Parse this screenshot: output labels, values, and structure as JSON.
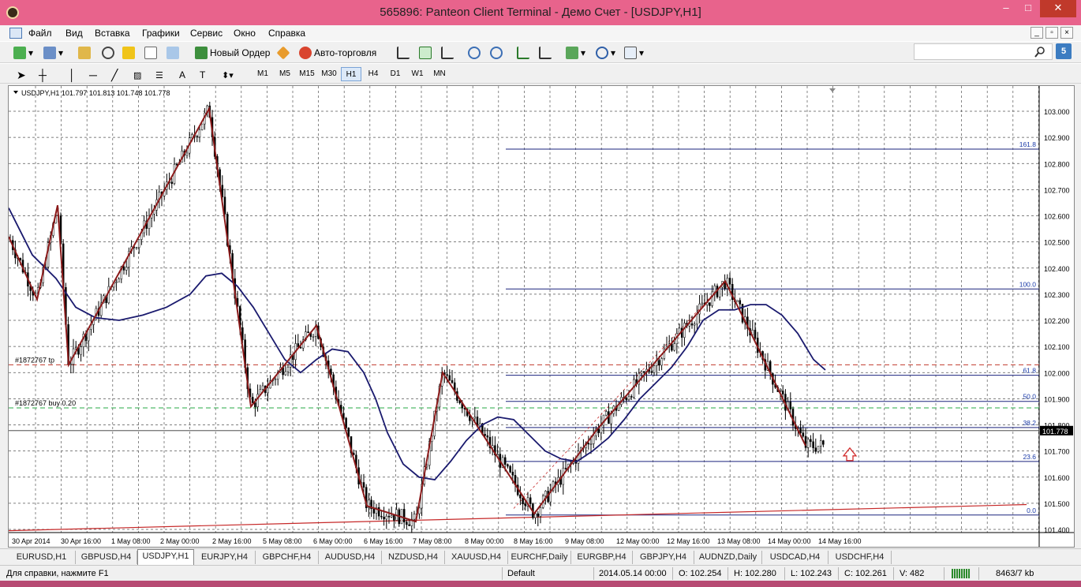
{
  "window": {
    "title": "565896: Panteon Client Terminal - Демо Счет - [USDJPY,H1]",
    "min_glyph": "–",
    "max_glyph": "□",
    "close_glyph": "✕"
  },
  "menu": [
    "Файл",
    "Вид",
    "Вставка",
    "Графики",
    "Сервис",
    "Окно",
    "Справка"
  ],
  "toolbar": {
    "new_order_label": "Новый Ордер",
    "autotrading_label": "Авто-торговля",
    "search_value": "",
    "alert_badge": "5"
  },
  "timeframes": [
    "M1",
    "M5",
    "M15",
    "M30",
    "H1",
    "H4",
    "D1",
    "W1",
    "MN"
  ],
  "active_timeframe": "H1",
  "chart_data": {
    "type": "line",
    "symbol_header": "USDJPY,H1  101.797 101.813 101.748 101.778",
    "y_ticks": [
      "103.000",
      "102.900",
      "102.800",
      "102.700",
      "102.600",
      "102.500",
      "102.400",
      "102.300",
      "102.200",
      "102.100",
      "102.000",
      "101.900",
      "101.800",
      "101.700",
      "101.600",
      "101.500",
      "101.400"
    ],
    "ylim": [
      101.38,
      103.06
    ],
    "x_ticks": [
      "30 Apr 2014",
      "30 Apr 16:00",
      "1 May 08:00",
      "2 May 00:00",
      "2 May 16:00",
      "5 May 08:00",
      "6 May 00:00",
      "6 May 16:00",
      "7 May 08:00",
      "8 May 00:00",
      "8 May 16:00",
      "9 May 08:00",
      "12 May 00:00",
      "12 May 16:00",
      "13 May 08:00",
      "14 May 00:00",
      "14 May 16:00"
    ],
    "current_price_label": "101.778",
    "current_price": 101.778,
    "order_lines": [
      {
        "label": "#1872767 tp",
        "price": 102.03,
        "color": "#c0392b"
      },
      {
        "label": "#1872767 buy 0.20",
        "price": 101.865,
        "color": "#27a844"
      }
    ],
    "fibo_levels": [
      {
        "label": "161.8",
        "price": 102.855
      },
      {
        "label": "100.0",
        "price": 102.32
      },
      {
        "label": "61.8",
        "price": 101.99
      },
      {
        "label": "50.0",
        "price": 101.89
      },
      {
        "label": "38.2",
        "price": 101.79
      },
      {
        "label": "23.6",
        "price": 101.66
      },
      {
        "label": "0.0",
        "price": 101.455
      }
    ],
    "zigzag": [
      [
        0,
        102.52
      ],
      [
        36,
        102.28
      ],
      [
        62,
        102.64
      ],
      [
        76,
        102.03
      ],
      [
        254,
        103.01
      ],
      [
        307,
        101.87
      ],
      [
        390,
        102.18
      ],
      [
        454,
        101.49
      ],
      [
        516,
        101.43
      ],
      [
        550,
        102.0
      ],
      [
        666,
        101.46
      ],
      [
        745,
        101.78
      ],
      [
        908,
        102.35
      ],
      [
        936,
        102.18
      ],
      [
        1010,
        101.72
      ]
    ],
    "moving_average": [
      [
        0,
        102.63
      ],
      [
        30,
        102.45
      ],
      [
        60,
        102.36
      ],
      [
        85,
        102.25
      ],
      [
        110,
        102.21
      ],
      [
        140,
        102.2
      ],
      [
        170,
        102.22
      ],
      [
        200,
        102.25
      ],
      [
        230,
        102.3
      ],
      [
        250,
        102.37
      ],
      [
        270,
        102.38
      ],
      [
        290,
        102.33
      ],
      [
        310,
        102.25
      ],
      [
        330,
        102.15
      ],
      [
        350,
        102.05
      ],
      [
        370,
        102.0
      ],
      [
        390,
        102.05
      ],
      [
        410,
        102.09
      ],
      [
        430,
        102.08
      ],
      [
        450,
        102.0
      ],
      [
        465,
        101.9
      ],
      [
        480,
        101.77
      ],
      [
        500,
        101.65
      ],
      [
        520,
        101.6
      ],
      [
        540,
        101.59
      ],
      [
        560,
        101.66
      ],
      [
        580,
        101.74
      ],
      [
        600,
        101.8
      ],
      [
        620,
        101.83
      ],
      [
        640,
        101.82
      ],
      [
        660,
        101.76
      ],
      [
        680,
        101.7
      ],
      [
        700,
        101.67
      ],
      [
        720,
        101.66
      ],
      [
        740,
        101.7
      ],
      [
        760,
        101.75
      ],
      [
        780,
        101.82
      ],
      [
        800,
        101.9
      ],
      [
        820,
        101.96
      ],
      [
        840,
        102.02
      ],
      [
        860,
        102.1
      ],
      [
        880,
        102.2
      ],
      [
        900,
        102.24
      ],
      [
        920,
        102.24
      ],
      [
        940,
        102.26
      ],
      [
        960,
        102.26
      ],
      [
        980,
        102.22
      ],
      [
        1000,
        102.15
      ],
      [
        1020,
        102.05
      ],
      [
        1035,
        102.01
      ]
    ],
    "trendline": [
      [
        0,
        101.395
      ],
      [
        1290,
        101.495
      ]
    ],
    "upper_trend_dashed": [
      [
        640,
        101.48
      ],
      [
        908,
        102.35
      ]
    ],
    "grid": true
  },
  "tabs": [
    "EURUSD,H1",
    "GBPUSD,H4",
    "USDJPY,H1",
    "EURJPY,H4",
    "GBPCHF,H4",
    "AUDUSD,H4",
    "NZDUSD,H4",
    "XAUUSD,H4",
    "EURCHF,Daily",
    "EURGBP,H4",
    "GBPJPY,H4",
    "AUDNZD,Daily",
    "USDCAD,H4",
    "USDCHF,H4"
  ],
  "active_tab": "USDJPY,H1",
  "status": {
    "help": "Для справки, нажмите F1",
    "profile": "Default",
    "datetime": "2014.05.14 00:00",
    "open": "O: 102.254",
    "high": "H: 102.280",
    "low": "L: 102.243",
    "close": "C: 102.261",
    "volume": "V: 482",
    "traffic": "8463/7 kb"
  }
}
